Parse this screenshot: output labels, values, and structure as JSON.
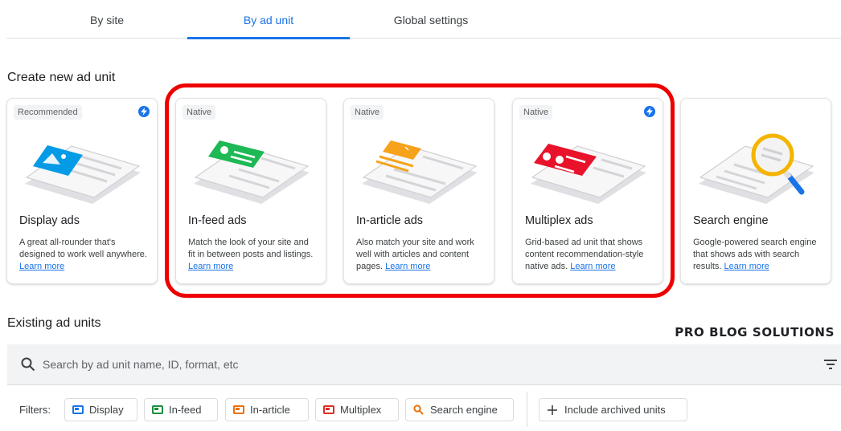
{
  "tabs": [
    {
      "label": "By site",
      "active": false
    },
    {
      "label": "By ad unit",
      "active": true
    },
    {
      "label": "Global settings",
      "active": false
    }
  ],
  "create_section": {
    "title": "Create new ad unit"
  },
  "cards": [
    {
      "badge": "Recommended",
      "bolt": true,
      "title": "Display ads",
      "desc": "A great all-rounder that's designed to work well anywhere.",
      "link": "Learn more",
      "accent": "#039be5",
      "icon": "display-ad-phone-icon"
    },
    {
      "badge": "Native",
      "bolt": false,
      "title": "In-feed ads",
      "desc": "Match the look of your site and fit in between posts and listings.",
      "link": "Learn more",
      "accent": "#1db954",
      "icon": "in-feed-ad-phone-icon"
    },
    {
      "badge": "Native",
      "bolt": false,
      "title": "In-article ads",
      "desc": "Also match your site and work well with articles and content pages.",
      "link": "Learn more",
      "accent": "#f6a21a",
      "icon": "in-article-ad-phone-icon"
    },
    {
      "badge": "Native",
      "bolt": true,
      "title": "Multiplex ads",
      "desc": "Grid-based ad unit that shows content recommendation-style native ads.",
      "link": "Learn more",
      "accent": "#e8122b",
      "icon": "multiplex-ad-phone-icon"
    },
    {
      "badge": "",
      "bolt": false,
      "title": "Search engine",
      "desc": "Google-powered search engine that shows ads with search results.",
      "link": "Learn more",
      "accent": "#f4b400",
      "icon": "search-engine-magnifier-icon"
    }
  ],
  "existing_section": {
    "title": "Existing ad units"
  },
  "watermark": "PRO BLOG SOLUTIONS",
  "search": {
    "placeholder": "Search by ad unit name, ID, format, etc"
  },
  "filters": {
    "label": "Filters:",
    "chips": [
      {
        "label": "Display",
        "color": "#1a73e8"
      },
      {
        "label": "In-feed",
        "color": "#1e8e3e"
      },
      {
        "label": "In-article",
        "color": "#e8710a"
      },
      {
        "label": "Multiplex",
        "color": "#d93025"
      },
      {
        "label": "Search engine",
        "color": "#e8710a"
      }
    ],
    "archived": "Include archived units"
  },
  "colors": {
    "accent": "#1a73e8",
    "highlight": "#ee0000"
  }
}
